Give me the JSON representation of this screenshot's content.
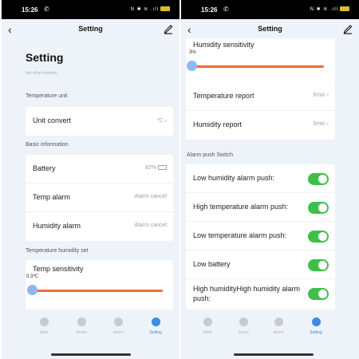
{
  "status": {
    "time": "15:26",
    "icons": "N ✱ ≋ .ıll",
    "battery": "36"
  },
  "nav": {
    "title": "Setting"
  },
  "left": {
    "page_title": "Setting",
    "page_subtitle": "Set other function",
    "temp_unit_section": "Temperature unit",
    "unit_convert": {
      "label": "Unit convert",
      "value": "℃"
    },
    "basic_section": "Basic information",
    "battery": {
      "label": "Battery",
      "value": "82%"
    },
    "temp_alarm": {
      "label": "Temp alarm",
      "value": "Alarm cancel"
    },
    "humidity_alarm": {
      "label": "Humidity alarm",
      "value": "Alarm cancel"
    },
    "temp_hum_section": "Temperature humidity set",
    "temp_sensitivity": {
      "label": "Temp sensitivity",
      "value_text": "0.3℃",
      "level": 0
    }
  },
  "right": {
    "humidity_sensitivity": {
      "label": "Humidity sensitivity",
      "value_text": "3%",
      "level": 0
    },
    "temperature_report": {
      "label": "Temperature report",
      "value": "5min"
    },
    "humidity_report": {
      "label": "Humidity report",
      "value": "5min"
    },
    "alarm_section": "Alarm push Switch",
    "switches": [
      {
        "label": "Low humidity alarm push:",
        "on": true
      },
      {
        "label": "High temperature alarm push:",
        "on": true
      },
      {
        "label": "Low temperature alarm push:",
        "on": true
      },
      {
        "label": "Low battery",
        "on": true
      },
      {
        "label_line1": "High humidityHigh humidity alarm",
        "label_line2": "push:",
        "on": true
      }
    ]
  },
  "tabs": [
    {
      "label": "Main",
      "icon": "home-icon",
      "active": false
    },
    {
      "label": "Smart",
      "icon": "smart-icon",
      "active": false
    },
    {
      "label": "Alarm",
      "icon": "bell-icon",
      "active": false
    },
    {
      "label": "Setting",
      "icon": "settings-icon",
      "active": true
    }
  ],
  "colors": {
    "accent": "#3d8ce6",
    "slider": "#f26a3d",
    "toggle_on": "#3fbf4a",
    "background": "#eef2f9"
  }
}
